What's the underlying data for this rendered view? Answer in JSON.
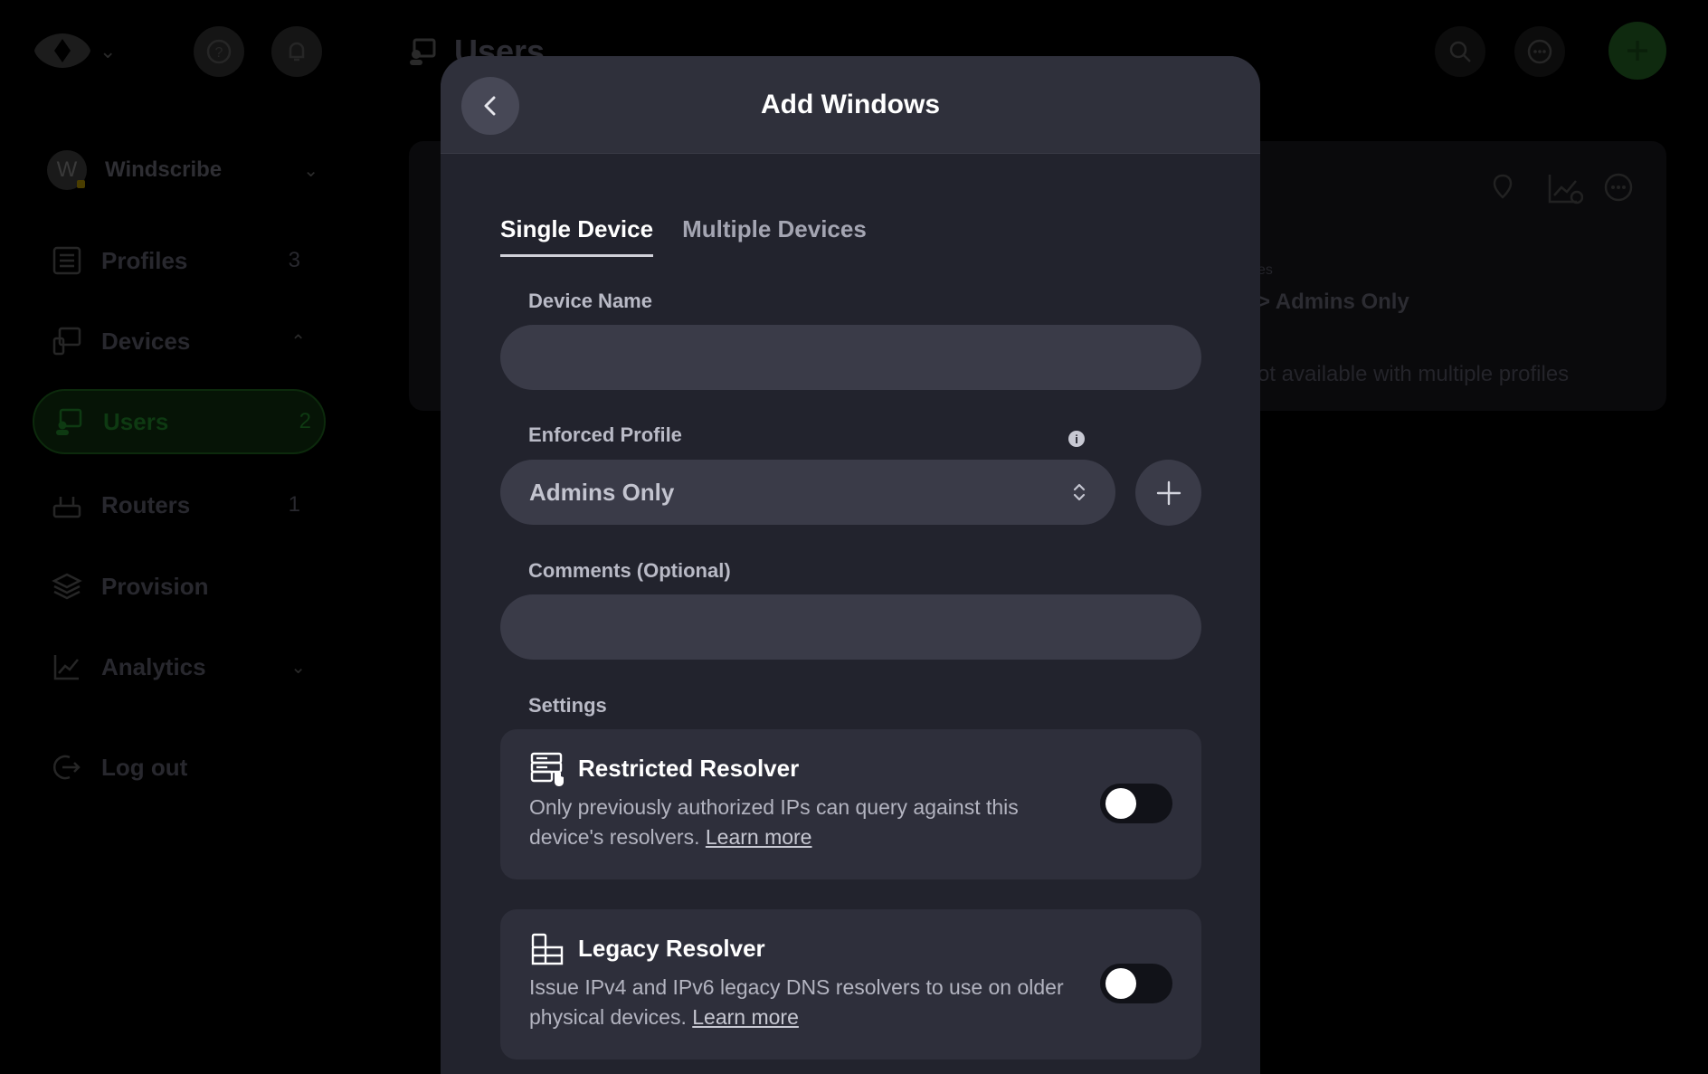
{
  "background": {
    "page_title": "Users",
    "org": {
      "initial": "W",
      "name": "Windscribe"
    },
    "nav": [
      {
        "label": "Profiles",
        "count": "3"
      },
      {
        "label": "Devices",
        "count": ""
      },
      {
        "label": "Users",
        "count": "2"
      },
      {
        "label": "Routers",
        "count": "1"
      },
      {
        "label": "Provision",
        "count": ""
      },
      {
        "label": "Analytics",
        "count": ""
      },
      {
        "label": "Log out",
        "count": ""
      }
    ],
    "card": {
      "row1_small": "es",
      "row1_value": "> Admins Only",
      "row2_value": "ot available with multiple profiles"
    }
  },
  "modal": {
    "title": "Add Windows",
    "tabs": [
      {
        "label": "Single Device",
        "active": true
      },
      {
        "label": "Multiple Devices",
        "active": false
      }
    ],
    "device_name": {
      "label": "Device Name",
      "value": "",
      "placeholder": ""
    },
    "enforced_profile": {
      "label": "Enforced Profile",
      "info": "i",
      "selected": "Admins Only"
    },
    "comments": {
      "label": "Comments (Optional)",
      "value": "",
      "placeholder": ""
    },
    "settings_label": "Settings",
    "settings": [
      {
        "title": "Restricted Resolver",
        "desc": "Only previously authorized IPs can query against this device's resolvers.",
        "link": "Learn more",
        "enabled": false
      },
      {
        "title": "Legacy Resolver",
        "desc": "Issue IPv4 and IPv6 legacy DNS resolvers to use on older physical devices.",
        "link": "Learn more",
        "enabled": false
      }
    ]
  },
  "colors": {
    "modal_bg": "#22232d",
    "modal_header": "#2f303b",
    "input_bg": "#3a3b48",
    "card_bg": "#2e2f3b",
    "accent_green": "#0f2a0f"
  }
}
